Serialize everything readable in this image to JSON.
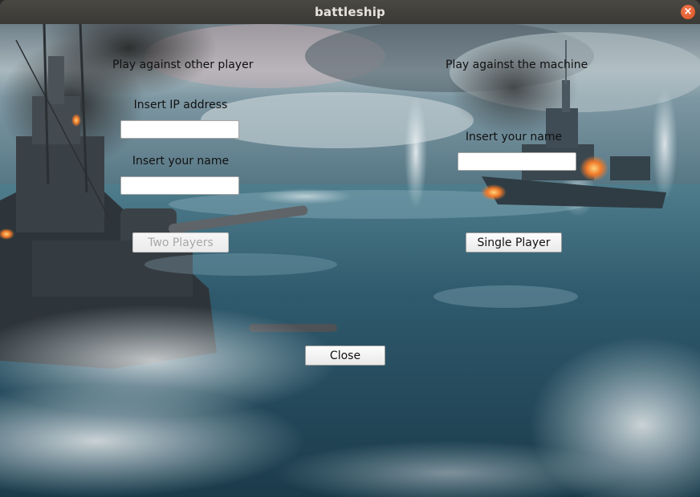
{
  "window": {
    "title": "battleship",
    "close_glyph": "×"
  },
  "multiplayer": {
    "heading": "Play against other player",
    "ip_label": "Insert IP address",
    "ip_value": "",
    "name_label": "Insert your name",
    "name_value": "",
    "button_label": "Two Players",
    "button_enabled": false
  },
  "singleplayer": {
    "heading": "Play against the machine",
    "name_label": "Insert your name",
    "name_value": "",
    "button_label": "Single Player",
    "button_enabled": true
  },
  "footer": {
    "close_label": "Close"
  },
  "colors": {
    "titlebar": "#3d3c38",
    "close_button": "#e05a2b",
    "sea": "#2c5468",
    "sky": "#8ea3ad"
  },
  "icons": {
    "close": "close-icon"
  }
}
